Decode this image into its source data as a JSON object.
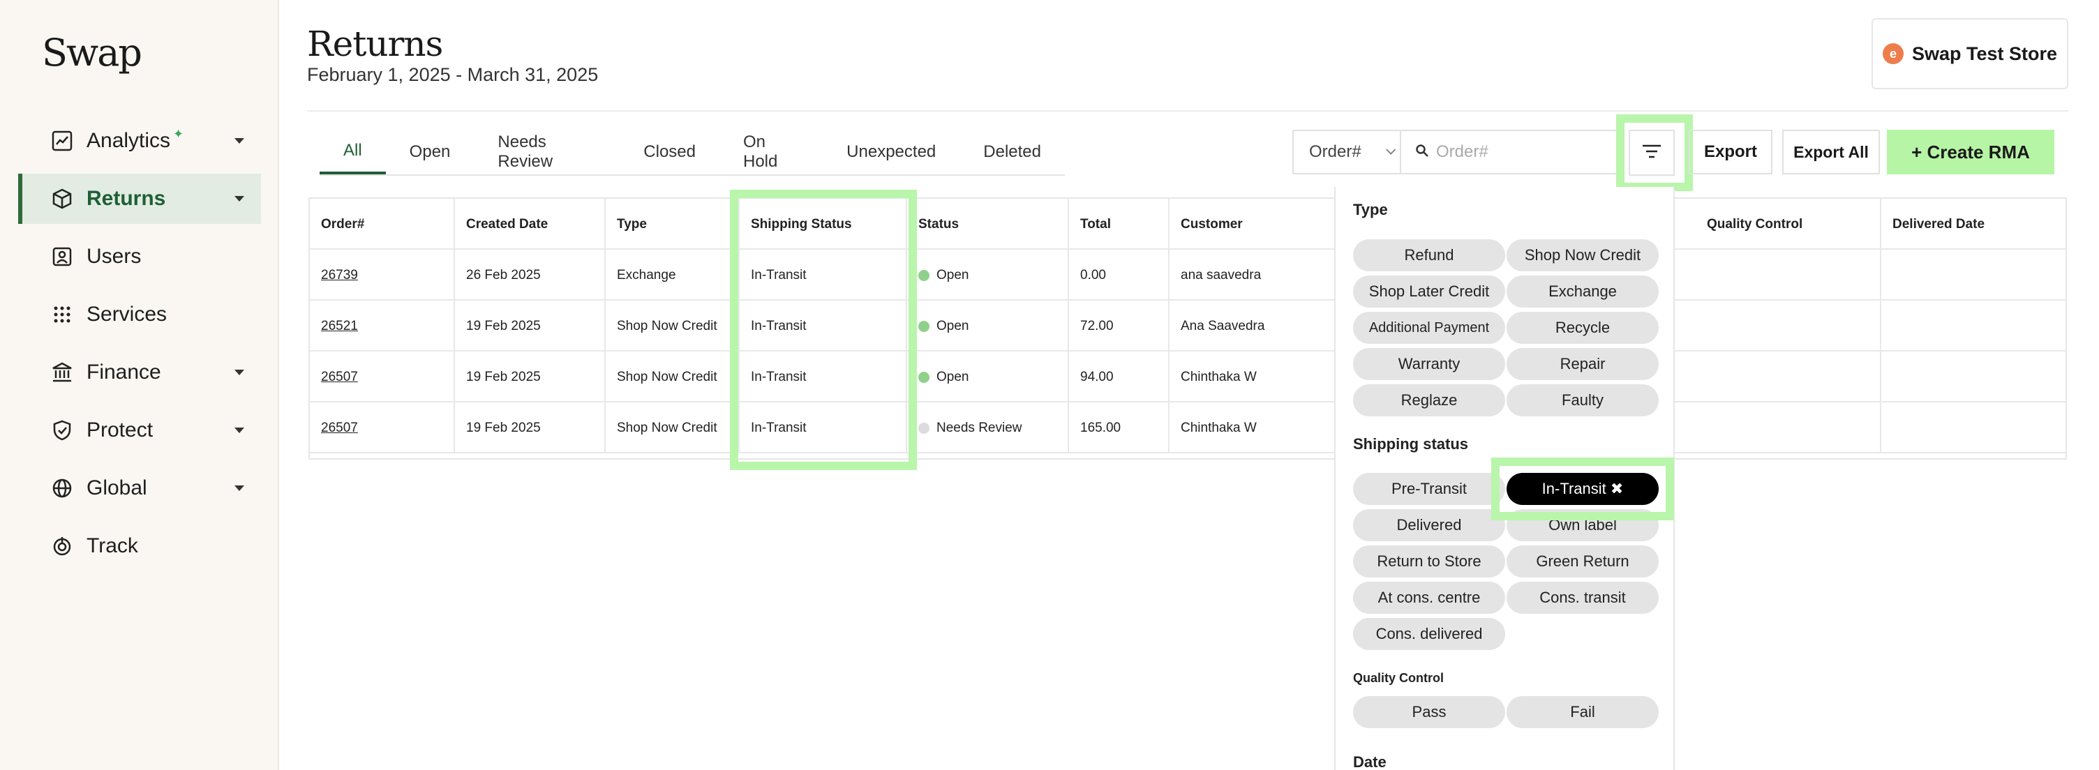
{
  "sidebar": {
    "logo": "Swap",
    "items": [
      {
        "label": "Analytics",
        "icon": "chart-icon",
        "caret": true,
        "active": false
      },
      {
        "label": "Returns",
        "icon": "box-icon",
        "caret": true,
        "active": true
      },
      {
        "label": "Users",
        "icon": "user-icon",
        "caret": false,
        "active": false
      },
      {
        "label": "Services",
        "icon": "grid-icon",
        "caret": false,
        "active": false
      },
      {
        "label": "Finance",
        "icon": "bank-icon",
        "caret": true,
        "active": false
      },
      {
        "label": "Protect",
        "icon": "shield-icon",
        "caret": true,
        "active": false
      },
      {
        "label": "Global",
        "icon": "globe-icon",
        "caret": true,
        "active": false
      },
      {
        "label": "Track",
        "icon": "track-icon",
        "caret": false,
        "active": false
      }
    ]
  },
  "header": {
    "title": "Returns",
    "date_range": "February 1, 2025 - March 31, 2025",
    "store_name": "Swap Test Store"
  },
  "tabs": [
    "All",
    "Open",
    "Needs Review",
    "Closed",
    "On Hold",
    "Unexpected",
    "Deleted"
  ],
  "toolbar": {
    "search_field": "Order#",
    "search_placeholder": "Order#",
    "export_label": "Export",
    "export_all_label": "Export All",
    "create_label": "+ Create RMA"
  },
  "table": {
    "columns": [
      "Order#",
      "Created Date",
      "Type",
      "Shipping Status",
      "Status",
      "Total",
      "Customer",
      "Quality Control",
      "Delivered Date"
    ],
    "rows": [
      {
        "order": "26739",
        "created": "26 Feb 2025",
        "type": "Exchange",
        "shipping": "In-Transit",
        "status": "Open",
        "status_color": "#8fd18a",
        "total": "0.00",
        "customer": "ana saavedra"
      },
      {
        "order": "26521",
        "created": "19 Feb 2025",
        "type": "Shop Now Credit",
        "shipping": "In-Transit",
        "status": "Open",
        "status_color": "#8fd18a",
        "total": "72.00",
        "customer": "Ana Saavedra"
      },
      {
        "order": "26507",
        "created": "19 Feb 2025",
        "type": "Shop Now Credit",
        "shipping": "In-Transit",
        "status": "Open",
        "status_color": "#8fd18a",
        "total": "94.00",
        "customer": "Chinthaka W"
      },
      {
        "order": "26507",
        "created": "19 Feb 2025",
        "type": "Shop Now Credit",
        "shipping": "In-Transit",
        "status": "Needs Review",
        "status_color": "#dcdcdc",
        "total": "165.00",
        "customer": "Chinthaka W"
      }
    ]
  },
  "filters": {
    "type_title": "Type",
    "type_chips": [
      "Refund",
      "Shop Now Credit",
      "Shop Later Credit",
      "Exchange",
      "Additional Payment",
      "Recycle",
      "Warranty",
      "Repair",
      "Reglaze",
      "Faulty"
    ],
    "shipping_title": "Shipping status",
    "shipping_chips": [
      "Pre-Transit",
      "In-Transit ✖",
      "Delivered",
      "Own label",
      "Return to Store",
      "Green Return",
      "At cons. centre",
      "Cons. transit",
      "Cons. delivered"
    ],
    "qc_title": "Quality Control",
    "qc_chips": [
      "Pass",
      "Fail"
    ],
    "date_title": "Date"
  },
  "colors": {
    "accent_green": "#b6f5a6",
    "highlight": "#b9f5aa",
    "active_tab": "#1f5f36",
    "sidebar_active": "#e2ece2"
  }
}
